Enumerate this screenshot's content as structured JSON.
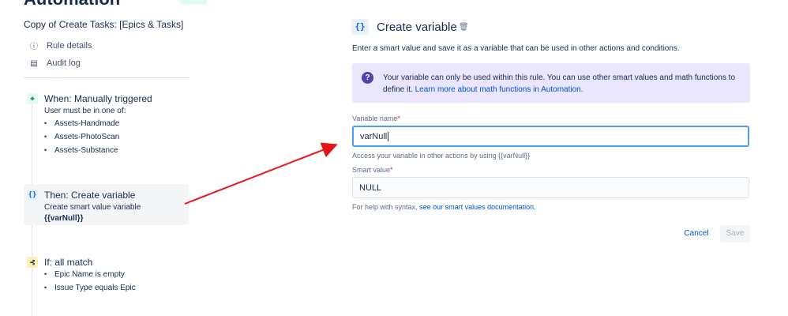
{
  "header": {
    "title": "Automation"
  },
  "sidebar": {
    "rule_name": "Copy of Create Tasks: [Epics & Tasks]",
    "menu": [
      {
        "label": "Rule details",
        "icon": "info-icon"
      },
      {
        "label": "Audit log",
        "icon": "document-icon"
      }
    ]
  },
  "flow": {
    "trigger": {
      "title": "When: Manually triggered",
      "subtitle": "User must be in one of:",
      "groups": [
        "Assets-Handmade",
        "Assets-PhotoScan",
        "Assets-Substance"
      ],
      "icon_color": "#36b37e"
    },
    "action": {
      "icon_text": "{}",
      "title": "Then: Create variable",
      "subtitle": "Create smart value variable",
      "value": "{{varNull}}"
    },
    "condition": {
      "title": "If: all match",
      "items": [
        "Epic Name is empty",
        "Issue Type equals Epic"
      ],
      "icon_color": "#ffe380"
    }
  },
  "panel": {
    "icon_text": "{}",
    "title": "Create variable",
    "description": "Enter a smart value and save it as a variable that can be used in other actions and conditions.",
    "info": {
      "text": "Your variable can only be used within this rule. You can use other smart values and math functions to define it.",
      "link": "Learn more about math functions in Automation."
    },
    "variable_name": {
      "label": "Variable name",
      "required": "*",
      "value": "varNull",
      "helper": "Access your variable in other actions by using {{varNull}}"
    },
    "smart_value": {
      "label": "Smart value",
      "required": "*",
      "value": "NULL",
      "helper": "For help with syntax,",
      "helper_link": "see our smart values documentation."
    },
    "buttons": {
      "cancel": "Cancel",
      "save": "Save"
    }
  },
  "colors": {
    "accent": "#0052cc",
    "info_bg": "#eae6ff",
    "focus": "#4c9aff",
    "annotation_arrow": "#e8141a"
  }
}
